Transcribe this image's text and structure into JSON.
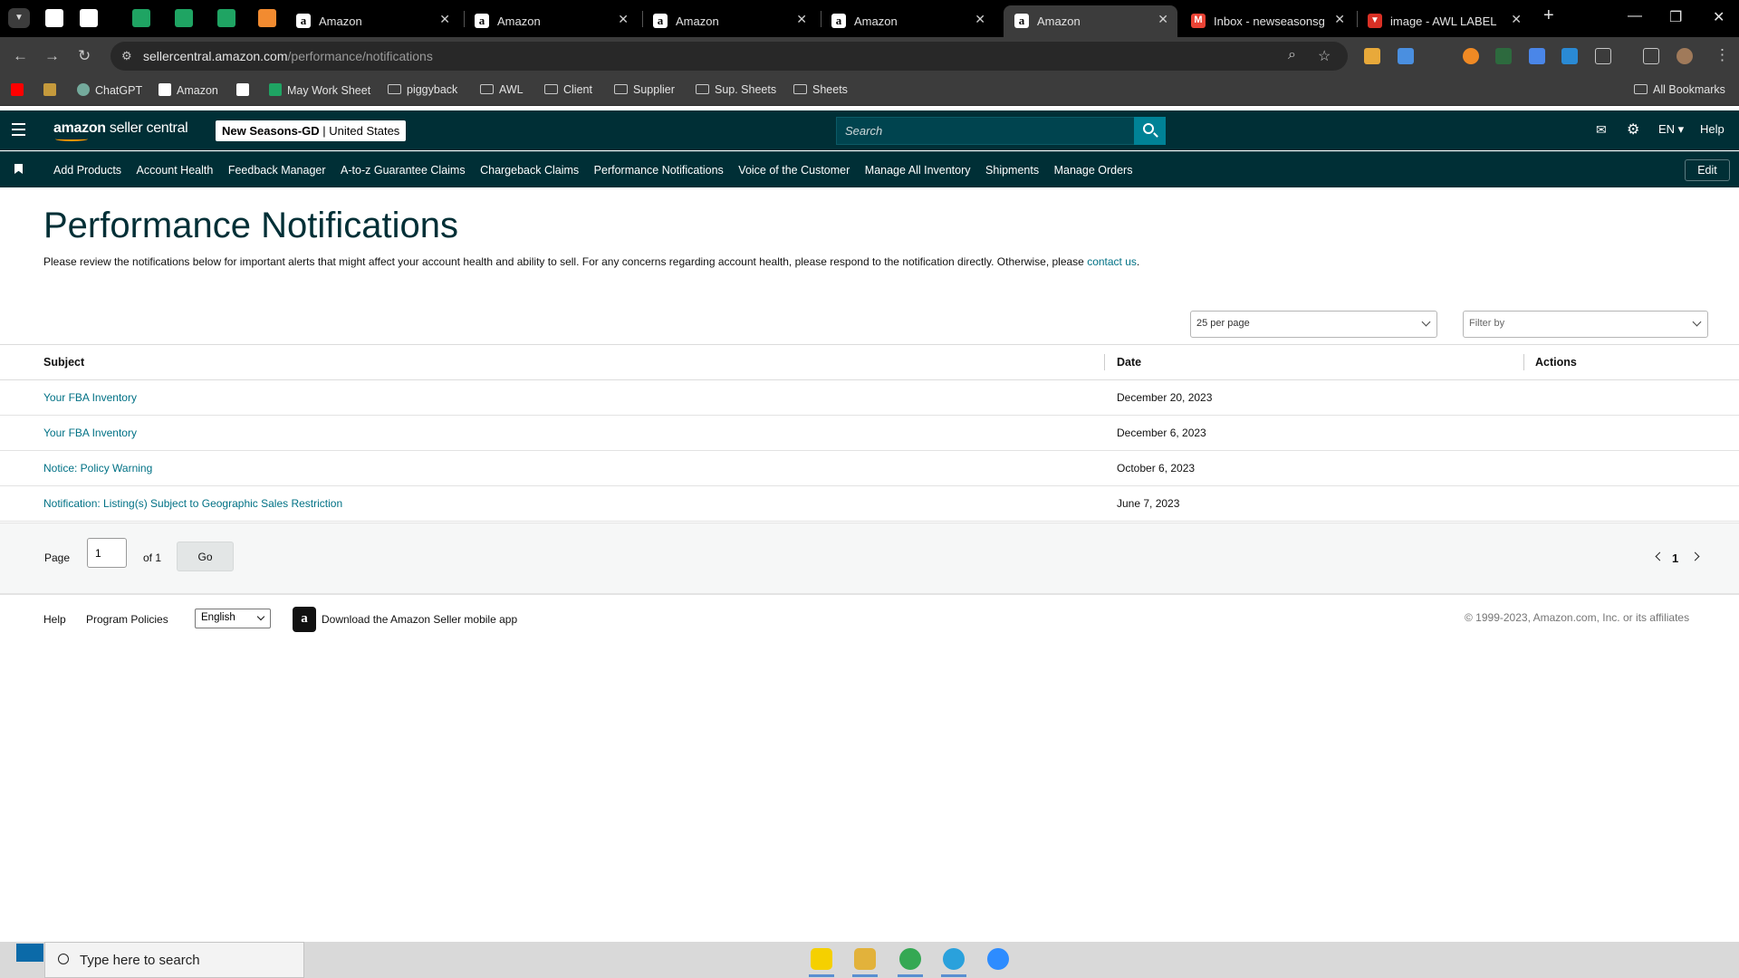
{
  "browser": {
    "tabs": [
      {
        "title": "Amazon",
        "active": false
      },
      {
        "title": "Amazon",
        "active": false
      },
      {
        "title": "Amazon",
        "active": false
      },
      {
        "title": "Amazon",
        "active": false
      },
      {
        "title": "Amazon",
        "active": true
      },
      {
        "title": "Inbox - newseasonsgd@",
        "active": false
      },
      {
        "title": "image - AWL LABEL",
        "active": false
      }
    ],
    "url_host": "sellercentral.amazon.com",
    "url_path": "/performance/notifications",
    "bookmarks": [
      {
        "label": "ChatGPT",
        "type": "site"
      },
      {
        "label": "Amazon",
        "type": "site"
      },
      {
        "label": "May Work Sheet",
        "type": "site"
      },
      {
        "label": "piggyback",
        "type": "folder"
      },
      {
        "label": "AWL",
        "type": "folder"
      },
      {
        "label": "Client",
        "type": "folder"
      },
      {
        "label": "Supplier",
        "type": "folder"
      },
      {
        "label": "Sup. Sheets",
        "type": "folder"
      },
      {
        "label": "Sheets",
        "type": "folder"
      }
    ],
    "all_bookmarks": "All Bookmarks"
  },
  "header": {
    "logo_bold": "amazon",
    "logo_rest": " seller central",
    "store_name": "New Seasons-GD",
    "store_region": " | United States",
    "search_placeholder": "Search",
    "language": "EN",
    "help": "Help"
  },
  "nav": {
    "links": [
      "Add Products",
      "Account Health",
      "Feedback Manager",
      "A-to-z Guarantee Claims",
      "Chargeback Claims",
      "Performance Notifications",
      "Voice of the Customer",
      "Manage All Inventory",
      "Shipments",
      "Manage Orders"
    ],
    "edit": "Edit"
  },
  "page": {
    "title": "Performance Notifications",
    "description": "Please review the notifications below for important alerts that might affect your account health and ability to sell. For any concerns regarding account health, please respond to the notification directly. Otherwise, please ",
    "contact_link": "contact us",
    "per_page": "25 per page",
    "filter_placeholder": "Filter by"
  },
  "table": {
    "columns": [
      "Subject",
      "Date",
      "Actions"
    ],
    "rows": [
      {
        "subject": "Your FBA Inventory",
        "date": "December 20, 2023"
      },
      {
        "subject": "Your FBA Inventory",
        "date": "December 6, 2023"
      },
      {
        "subject": "Notice: Policy Warning",
        "date": "October 6, 2023"
      },
      {
        "subject": "Notification: Listing(s) Subject to Geographic Sales Restriction",
        "date": "June 7, 2023"
      }
    ]
  },
  "pager": {
    "page_label": "Page",
    "page_value": "1",
    "of_label": "of 1",
    "go": "Go",
    "current": "1"
  },
  "footer": {
    "help": "Help",
    "policies": "Program Policies",
    "language": "English",
    "app_text": "Download the Amazon Seller mobile app",
    "copyright": "© 1999-2023, Amazon.com, Inc. or its affiliates"
  },
  "taskbar": {
    "search_placeholder": "Type here to search"
  },
  "colors": {
    "header_bg": "#002f36",
    "search_btn": "#008296",
    "link": "#007185",
    "accent": "#ff9900"
  }
}
